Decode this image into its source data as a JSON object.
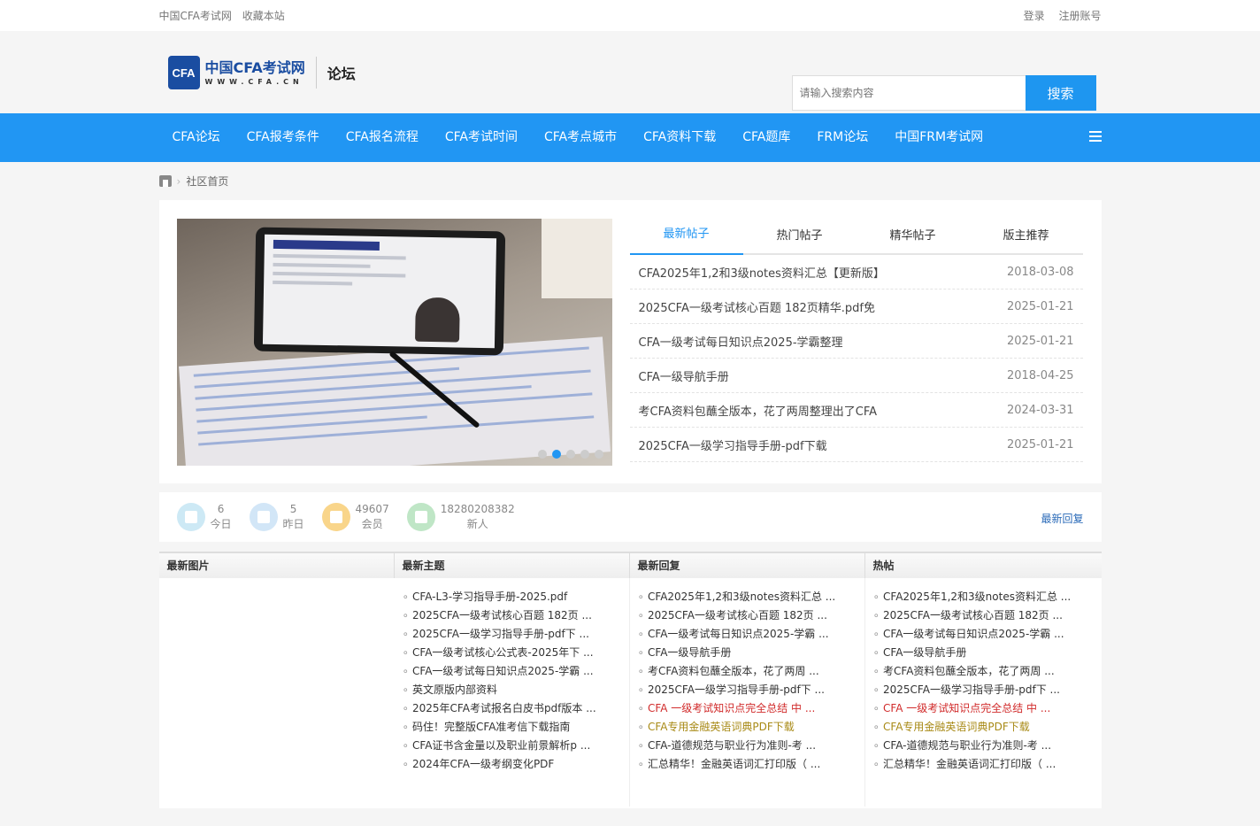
{
  "topbar": {
    "site_name": "中国CFA考试网",
    "bookmark": "收藏本站",
    "login": "登录",
    "register": "注册账号"
  },
  "header": {
    "logo_badge": "CFA",
    "logo_cn": "中国CFA考试网",
    "logo_en": "WWW.CFA.CN",
    "section": "论坛",
    "search_placeholder": "请输入搜索内容",
    "search_button": "搜索"
  },
  "nav": {
    "items": [
      "CFA论坛",
      "CFA报考条件",
      "CFA报名流程",
      "CFA考试时间",
      "CFA考点城市",
      "CFA资料下载",
      "CFA题库",
      "FRM论坛",
      "中国FRM考试网"
    ],
    "menu_icon": "list-icon"
  },
  "breadcrumb": {
    "home_icon": "home-icon",
    "current": "社区首页"
  },
  "tabs": {
    "labels": [
      "最新帖子",
      "热门帖子",
      "精华帖子",
      "版主推荐"
    ],
    "active": 0,
    "threads": [
      {
        "title": "CFA2025年1,2和3级notes资料汇总【更新版】",
        "date": "2018-03-08"
      },
      {
        "title": "2025CFA一级考试核心百题 182页精华.pdf免",
        "date": "2025-01-21"
      },
      {
        "title": "CFA一级考试每日知识点2025-学霸整理",
        "date": "2025-01-21"
      },
      {
        "title": "CFA一级导航手册",
        "date": "2018-04-25"
      },
      {
        "title": "考CFA资料包蘸全版本，花了两周整理出了CFA",
        "date": "2024-03-31"
      },
      {
        "title": "2025CFA一级学习指导手册-pdf下载",
        "date": "2025-01-21"
      }
    ]
  },
  "slider": {
    "dot_count": 5,
    "active_dot": 1
  },
  "stats": {
    "today_num": "6",
    "today_label": "今日",
    "yesterday_num": "5",
    "yesterday_label": "昨日",
    "members_num": "49607",
    "members_label": "会员",
    "newest_num": "18280208382",
    "newest_label": "新人",
    "latest_reply": "最新回复"
  },
  "lists": {
    "headers": [
      "最新图片",
      "最新主题",
      "最新回复",
      "热帖"
    ],
    "latest_topics": [
      "CFA-L3-学习指导手册-2025.pdf",
      "2025CFA一级考试核心百题 182页 ...",
      "2025CFA一级学习指导手册-pdf下 ...",
      "CFA一级考试核心公式表-2025年下 ...",
      "CFA一级考试每日知识点2025-学霸 ...",
      "英文原版内部资料",
      "2025年CFA考试报名白皮书pdf版本 ...",
      "码住！完整版CFA准考信下载指南",
      "CFA证书含金量以及职业前景解析p ...",
      "2024年CFA一级考纲变化PDF"
    ],
    "latest_replies": [
      {
        "text": "CFA2025年1,2和3级notes资料汇总 ...",
        "style": ""
      },
      {
        "text": "2025CFA一级考试核心百题 182页 ...",
        "style": ""
      },
      {
        "text": "CFA一级考试每日知识点2025-学霸 ...",
        "style": ""
      },
      {
        "text": "CFA一级导航手册",
        "style": ""
      },
      {
        "text": "考CFA资料包蘸全版本，花了两周 ...",
        "style": ""
      },
      {
        "text": "2025CFA一级学习指导手册-pdf下 ...",
        "style": ""
      },
      {
        "text": "CFA 一级考试知识点完全总结 中 ...",
        "style": "red"
      },
      {
        "text": "CFA专用金融英语词典PDF下载",
        "style": "gold"
      },
      {
        "text": "CFA-道德规范与职业行为准则-考 ...",
        "style": ""
      },
      {
        "text": "汇总精华！金融英语词汇打印版（ ...",
        "style": ""
      }
    ],
    "hot_threads": [
      {
        "text": "CFA2025年1,2和3级notes资料汇总 ...",
        "style": ""
      },
      {
        "text": "2025CFA一级考试核心百题 182页 ...",
        "style": ""
      },
      {
        "text": "CFA一级考试每日知识点2025-学霸 ...",
        "style": ""
      },
      {
        "text": "CFA一级导航手册",
        "style": ""
      },
      {
        "text": "考CFA资料包蘸全版本，花了两周 ...",
        "style": ""
      },
      {
        "text": "2025CFA一级学习指导手册-pdf下 ...",
        "style": ""
      },
      {
        "text": "CFA 一级考试知识点完全总结 中 ...",
        "style": "red"
      },
      {
        "text": "CFA专用金融英语词典PDF下载",
        "style": "gold"
      },
      {
        "text": "CFA-道德规范与职业行为准则-考 ...",
        "style": ""
      },
      {
        "text": "汇总精华！金融英语词汇打印版（ ...",
        "style": ""
      }
    ]
  },
  "colors": {
    "nav_blue": "#2196f3",
    "logo_blue": "#1a4da1",
    "highlight_red": "#d12b2b",
    "highlight_gold": "#a88a16"
  }
}
